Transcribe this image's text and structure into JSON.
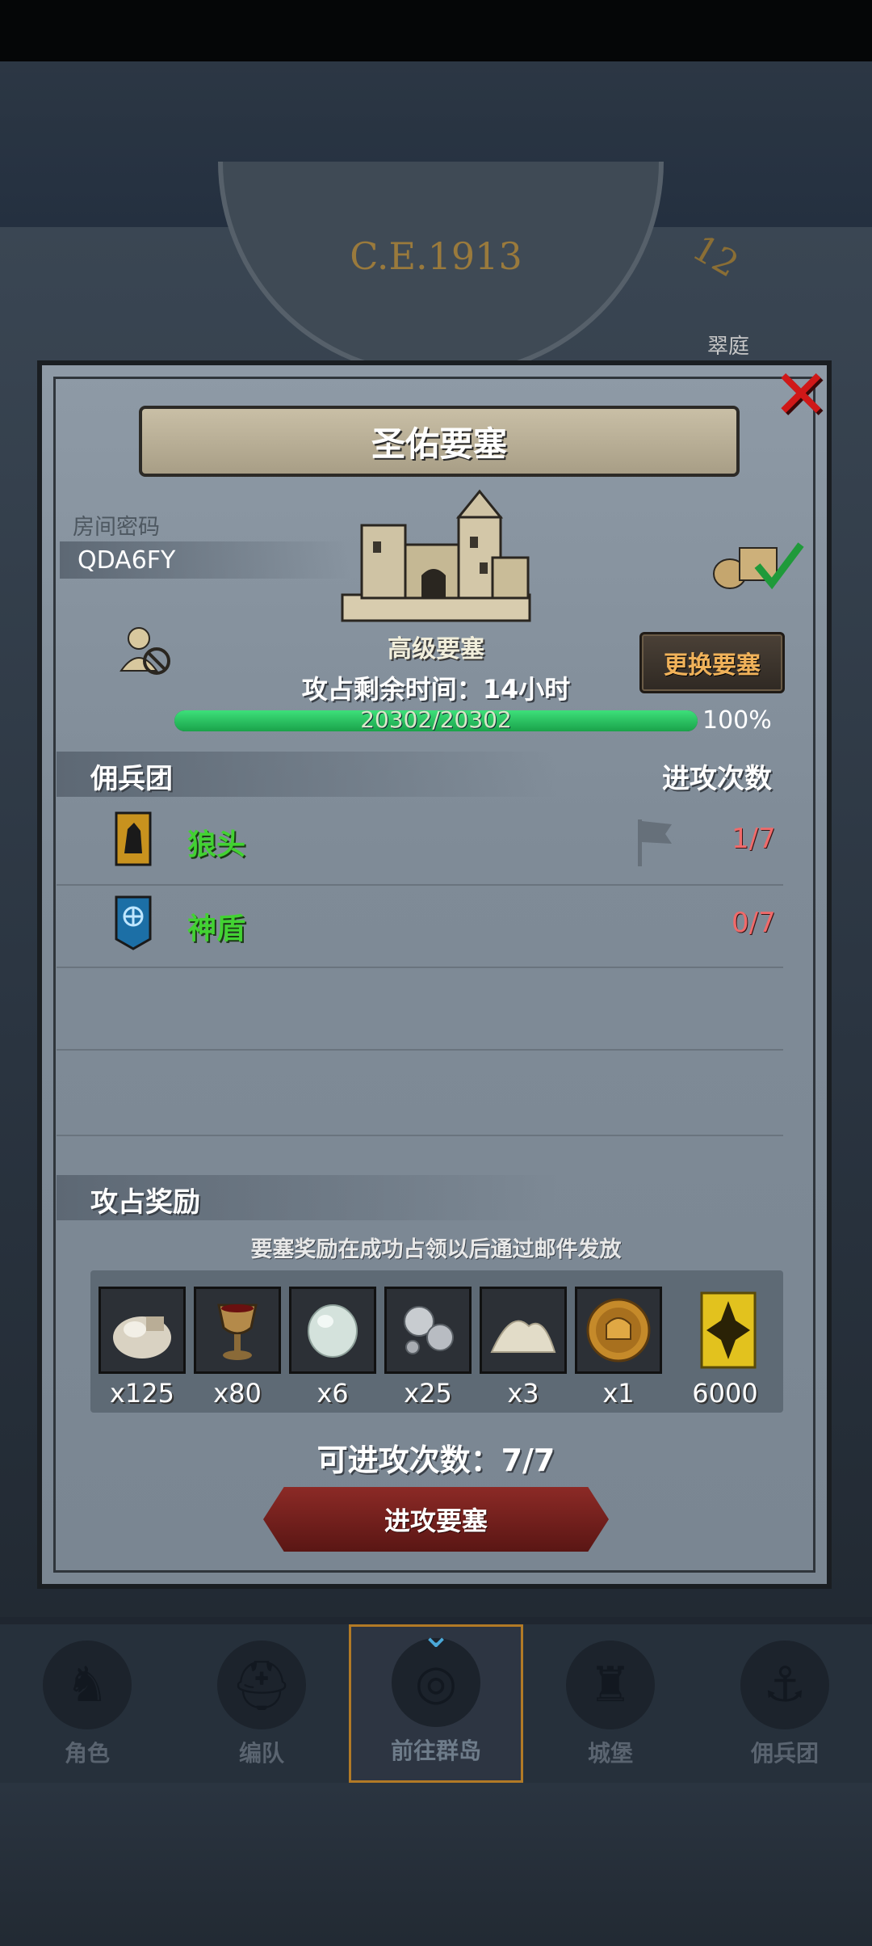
{
  "background": {
    "era": "C.E.1913",
    "dial_number": "12",
    "side_tag": "翠庭"
  },
  "modal": {
    "title": "圣佑要塞",
    "close_icon": "close-x-icon",
    "room": {
      "label": "房间密码",
      "code": "QDA6FY"
    },
    "fortress": {
      "level": "高级要塞",
      "remaining_time": "攻占剩余时间：14小时",
      "change_button": "更换要塞"
    },
    "hp": {
      "text": "20302/20302",
      "percent_label": "100%",
      "fraction": 1.0
    },
    "mercenaries": {
      "header_left": "佣兵团",
      "header_right": "进攻次数",
      "rows": [
        {
          "name": "狼头",
          "attempts": "1/7",
          "icon": "wolf-banner-icon"
        },
        {
          "name": "神盾",
          "attempts": "0/7",
          "icon": "shield-banner-icon"
        }
      ]
    },
    "rewards": {
      "header": "攻占奖励",
      "note": "要塞奖励在成功占领以后通过邮件发放",
      "items": [
        {
          "icon": "flour-sack-icon",
          "qty": "x125"
        },
        {
          "icon": "goblet-icon",
          "qty": "x80"
        },
        {
          "icon": "moonstone-icon",
          "qty": "x6"
        },
        {
          "icon": "silver-ore-icon",
          "qty": "x25"
        },
        {
          "icon": "salt-pile-icon",
          "qty": "x3"
        },
        {
          "icon": "gold-helmet-coin-icon",
          "qty": "x1"
        },
        {
          "icon": "gold-rank-emblem-icon",
          "qty": "6000"
        }
      ]
    },
    "attack_count": "可进攻次数：7/7",
    "attack_button": "进攻要塞"
  },
  "nav": {
    "items": [
      {
        "label": "角色",
        "icon": "knight-icon"
      },
      {
        "label": "编队",
        "icon": "helmet-icon"
      },
      {
        "label": "前往群岛",
        "icon": "globe-icon"
      },
      {
        "label": "城堡",
        "icon": "castle-icon"
      },
      {
        "label": "佣兵团",
        "icon": "ship-icon"
      }
    ],
    "active_index": 2
  },
  "colors": {
    "hp_fill": "#1fb14f",
    "merc_name": "#42d232",
    "merc_count": "#f06a6a",
    "change_button_text": "#f0b25a",
    "attack_button": "#7a2220",
    "close": "#d01818"
  }
}
